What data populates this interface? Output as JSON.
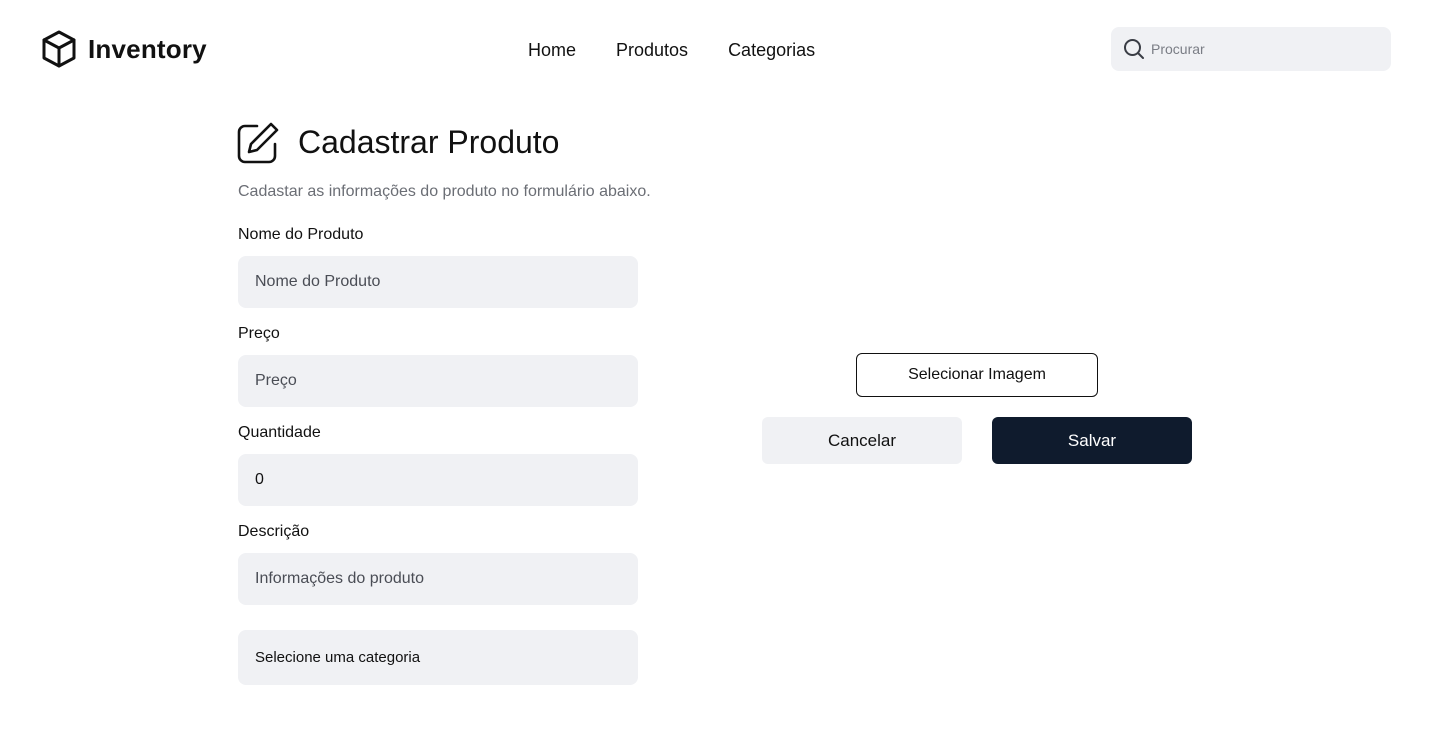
{
  "header": {
    "brand": {
      "name": "Inventory",
      "icon": "box-icon"
    },
    "nav": [
      {
        "label": "Home"
      },
      {
        "label": "Produtos"
      },
      {
        "label": "Categorias"
      }
    ],
    "search": {
      "placeholder": "Procurar",
      "value": "",
      "icon": "search-icon"
    }
  },
  "form": {
    "icon": "edit-icon",
    "title": "Cadastrar Produto",
    "subtitle": "Cadastar as informações do produto no formulário abaixo.",
    "fields": {
      "name": {
        "label": "Nome do Produto",
        "placeholder": "Nome do Produto",
        "value": ""
      },
      "price": {
        "label": "Preço",
        "placeholder": "Preço",
        "value": ""
      },
      "quantity": {
        "label": "Quantidade",
        "placeholder": "",
        "value": "0"
      },
      "description": {
        "label": "Descrição",
        "placeholder": "Informações do produto",
        "value": ""
      }
    },
    "category_select": {
      "selected": "Selecione uma categoria"
    }
  },
  "actions": {
    "select_image_label": "Selecionar Imagem",
    "cancel_label": "Cancelar",
    "save_label": "Salvar"
  },
  "colors": {
    "primary_button": "#0f1b2d",
    "input_background": "#f0f1f4",
    "muted_text": "#6b6e75"
  }
}
